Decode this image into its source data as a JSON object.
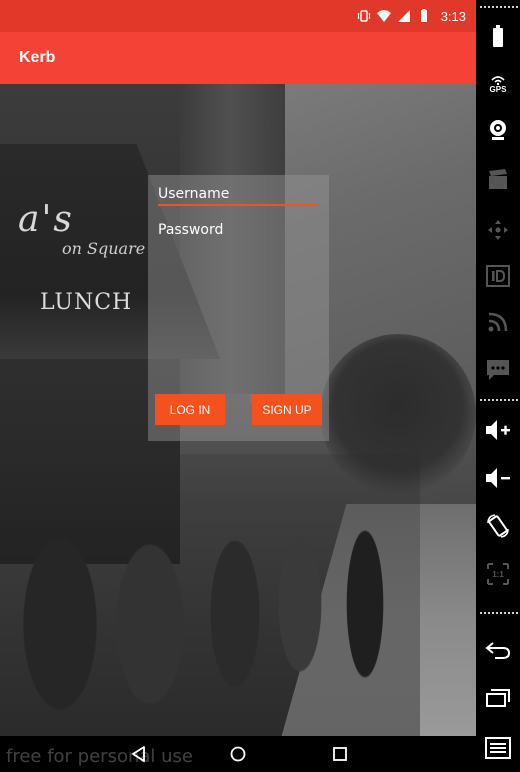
{
  "status_bar": {
    "time": "3:13",
    "icons": [
      "vibrate-icon",
      "wifi-icon",
      "signal-icon",
      "battery-icon"
    ]
  },
  "app_bar": {
    "title": "Kerb"
  },
  "background": {
    "awning_text": "a's",
    "awning_subtext": "on Square",
    "awning_lunch": "LUNCH"
  },
  "login": {
    "username_placeholder": "Username",
    "password_placeholder": "Password",
    "login_label": "LOG IN",
    "signup_label": "SIGN UP"
  },
  "watermark": "free for personal use",
  "toolbar": {
    "gps_label": "GPS",
    "items": [
      "battery-icon",
      "gps-icon",
      "camera-icon",
      "media-icon",
      "dpad-icon",
      "id-icon",
      "rss-icon",
      "sms-icon",
      "volume-up-icon",
      "volume-down-icon",
      "rotate-icon",
      "scale-icon",
      "back-icon",
      "recents-icon",
      "menu-icon"
    ]
  },
  "colors": {
    "status_bar": "#e0392a",
    "app_bar": "#f44336",
    "accent": "#f4511e"
  }
}
